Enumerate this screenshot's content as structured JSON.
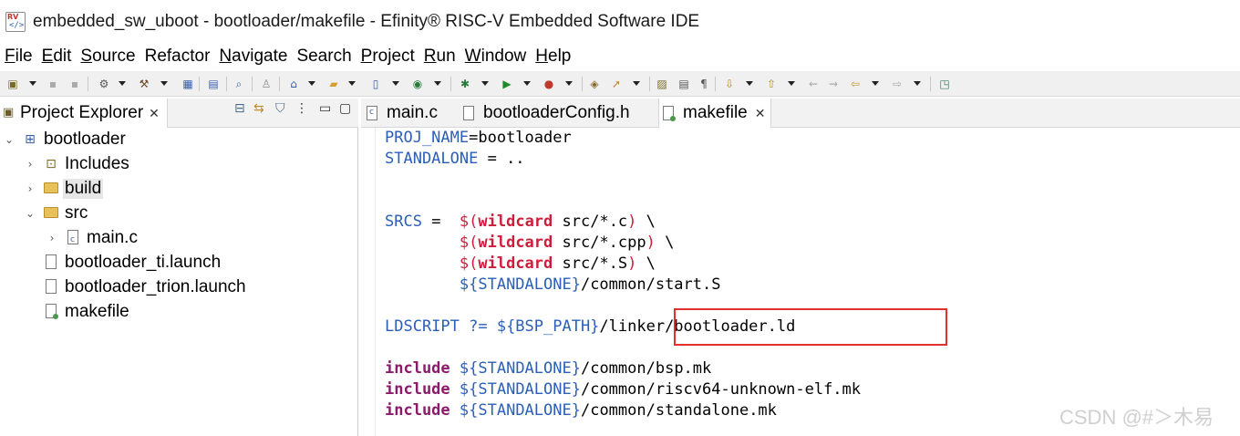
{
  "window": {
    "title": "embedded_sw_uboot - bootloader/makefile - Efinity® RISC-V Embedded Software IDE",
    "app_icon_text": "RV"
  },
  "menu": [
    {
      "label": "File",
      "mnemonic": "F",
      "rest": "ile"
    },
    {
      "label": "Edit",
      "mnemonic": "E",
      "rest": "dit"
    },
    {
      "label": "Source",
      "mnemonic": "S",
      "rest": "ource"
    },
    {
      "label": "Refactor",
      "mnemonic": "",
      "rest": "Refactor"
    },
    {
      "label": "Navigate",
      "mnemonic": "N",
      "rest": "avigate"
    },
    {
      "label": "Search",
      "mnemonic": "",
      "rest": "Search"
    },
    {
      "label": "Project",
      "mnemonic": "P",
      "rest": "roject"
    },
    {
      "label": "Run",
      "mnemonic": "R",
      "rest": "un"
    },
    {
      "label": "Window",
      "mnemonic": "W",
      "rest": "indow"
    },
    {
      "label": "Help",
      "mnemonic": "H",
      "rest": "elp"
    }
  ],
  "project_explorer": {
    "tab_label": "Project Explorer",
    "tree": [
      {
        "label": "bootloader",
        "icon": "project-icon",
        "expanded": true
      },
      {
        "label": "Includes",
        "icon": "includes-icon",
        "expanded": false
      },
      {
        "label": "build",
        "icon": "folder-icon",
        "expanded": false,
        "selected": true
      },
      {
        "label": "src",
        "icon": "folder-icon",
        "expanded": true
      },
      {
        "label": "main.c",
        "icon": "c-file-icon",
        "expanded": false
      },
      {
        "label": "bootloader_ti.launch",
        "icon": "launch-file-icon"
      },
      {
        "label": "bootloader_trion.launch",
        "icon": "launch-file-icon"
      },
      {
        "label": "makefile",
        "icon": "makefile-icon"
      }
    ]
  },
  "editor": {
    "tabs": [
      {
        "label": "main.c",
        "active": false
      },
      {
        "label": "bootloaderConfig.h",
        "active": false
      },
      {
        "label": "makefile",
        "active": true
      }
    ],
    "code": {
      "l1_var": "PROJ_NAME",
      "l1_rest": "=bootloader",
      "l2_var": "STANDALONE",
      "l2_rest": " = ..",
      "srcs_var": "SRCS",
      "srcs_op": " =  ",
      "wildcard_open": "$(",
      "wildcard_fn": "wildcard",
      "src_c": " src/*.c",
      "src_cpp": " src/*.cpp",
      "src_s": " src/*.S",
      "close_paren": ")",
      "cont": " \\",
      "indent": "        ",
      "standalone_ref": "${STANDALONE}",
      "start_s": "/common/start.S",
      "ld_var": "LDSCRIPT ?= ",
      "bsp_ref": "${BSP_PATH}",
      "ld_path": "/linker/bootloader.ld",
      "include_kw": "include",
      "inc1": "/common/bsp.mk",
      "inc2": "/common/riscv64-unknown-elf.mk",
      "inc3": "/common/standalone.mk"
    }
  },
  "watermark": "CSDN @#＞木易",
  "colors": {
    "variable": "#2b5fb8",
    "macro": "#cc1e3a",
    "keyword": "#8a1a6a",
    "highlight_box": "#e0312e"
  }
}
